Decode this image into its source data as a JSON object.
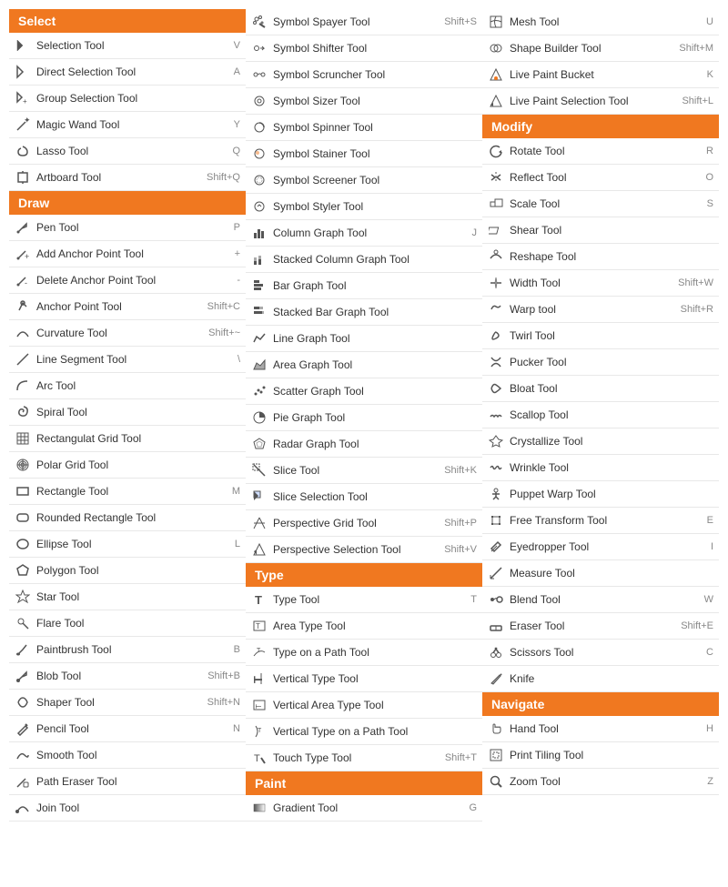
{
  "columns": [
    {
      "sections": [
        {
          "header": "Select",
          "tools": [
            {
              "name": "Selection Tool",
              "shortcut": "V",
              "icon": "arrow"
            },
            {
              "name": "Direct Selection Tool",
              "shortcut": "A",
              "icon": "arrow-hollow"
            },
            {
              "name": "Group Selection Tool",
              "shortcut": "",
              "icon": "arrow-plus"
            },
            {
              "name": "Magic Wand Tool",
              "shortcut": "Y",
              "icon": "wand"
            },
            {
              "name": "Lasso Tool",
              "shortcut": "Q",
              "icon": "lasso"
            },
            {
              "name": "Artboard Tool",
              "shortcut": "Shift+Q",
              "icon": "artboard"
            }
          ]
        },
        {
          "header": "Draw",
          "tools": [
            {
              "name": "Pen Tool",
              "shortcut": "P",
              "icon": "pen"
            },
            {
              "name": "Add Anchor Point Tool",
              "shortcut": "+",
              "icon": "pen-plus"
            },
            {
              "name": "Delete Anchor Point Tool",
              "shortcut": "-",
              "icon": "pen-minus"
            },
            {
              "name": "Anchor Point Tool",
              "shortcut": "Shift+C",
              "icon": "anchor"
            },
            {
              "name": "Curvature Tool",
              "shortcut": "Shift+~",
              "icon": "curvature"
            },
            {
              "name": "Line Segment Tool",
              "shortcut": "\\",
              "icon": "line"
            },
            {
              "name": "Arc Tool",
              "shortcut": "",
              "icon": "arc"
            },
            {
              "name": "Spiral Tool",
              "shortcut": "",
              "icon": "spiral"
            },
            {
              "name": "Rectangulat Grid Tool",
              "shortcut": "",
              "icon": "rect-grid"
            },
            {
              "name": "Polar Grid Tool",
              "shortcut": "",
              "icon": "polar-grid"
            },
            {
              "name": "Rectangle Tool",
              "shortcut": "M",
              "icon": "rect"
            },
            {
              "name": "Rounded Rectangle Tool",
              "shortcut": "",
              "icon": "rounded-rect"
            },
            {
              "name": "Ellipse Tool",
              "shortcut": "L",
              "icon": "ellipse"
            },
            {
              "name": "Polygon Tool",
              "shortcut": "",
              "icon": "polygon"
            },
            {
              "name": "Star Tool",
              "shortcut": "",
              "icon": "star"
            },
            {
              "name": "Flare Tool",
              "shortcut": "",
              "icon": "flare"
            },
            {
              "name": "Paintbrush Tool",
              "shortcut": "B",
              "icon": "brush"
            },
            {
              "name": "Blob Tool",
              "shortcut": "Shift+B",
              "icon": "blob"
            },
            {
              "name": "Shaper Tool",
              "shortcut": "Shift+N",
              "icon": "shaper"
            },
            {
              "name": "Pencil Tool",
              "shortcut": "N",
              "icon": "pencil"
            },
            {
              "name": "Smooth Tool",
              "shortcut": "",
              "icon": "smooth"
            },
            {
              "name": "Path Eraser Tool",
              "shortcut": "",
              "icon": "path-eraser"
            },
            {
              "name": "Join Tool",
              "shortcut": "",
              "icon": "join"
            }
          ]
        }
      ]
    },
    {
      "sections": [
        {
          "header": "",
          "tools": [
            {
              "name": "Symbol Spayer Tool",
              "shortcut": "Shift+S",
              "icon": "symbol-spray"
            },
            {
              "name": "Symbol Shifter Tool",
              "shortcut": "",
              "icon": "symbol-shift"
            },
            {
              "name": "Symbol Scruncher Tool",
              "shortcut": "",
              "icon": "symbol-scrunch"
            },
            {
              "name": "Symbol Sizer Tool",
              "shortcut": "",
              "icon": "symbol-size"
            },
            {
              "name": "Symbol Spinner Tool",
              "shortcut": "",
              "icon": "symbol-spin"
            },
            {
              "name": "Symbol Stainer Tool",
              "shortcut": "",
              "icon": "symbol-stain"
            },
            {
              "name": "Symbol Screener Tool",
              "shortcut": "",
              "icon": "symbol-screen"
            },
            {
              "name": "Symbol Styler Tool",
              "shortcut": "",
              "icon": "symbol-style"
            },
            {
              "name": "Column Graph Tool",
              "shortcut": "J",
              "icon": "col-graph"
            },
            {
              "name": "Stacked Column Graph Tool",
              "shortcut": "",
              "icon": "stacked-col-graph"
            },
            {
              "name": "Bar Graph Tool",
              "shortcut": "",
              "icon": "bar-graph"
            },
            {
              "name": "Stacked Bar Graph Tool",
              "shortcut": "",
              "icon": "stacked-bar-graph"
            },
            {
              "name": "Line Graph Tool",
              "shortcut": "",
              "icon": "line-graph"
            },
            {
              "name": "Area Graph Tool",
              "shortcut": "",
              "icon": "area-graph"
            },
            {
              "name": "Scatter Graph Tool",
              "shortcut": "",
              "icon": "scatter-graph"
            },
            {
              "name": "Pie Graph Tool",
              "shortcut": "",
              "icon": "pie-graph"
            },
            {
              "name": "Radar Graph Tool",
              "shortcut": "",
              "icon": "radar-graph"
            },
            {
              "name": "Slice Tool",
              "shortcut": "Shift+K",
              "icon": "slice"
            },
            {
              "name": "Slice Selection Tool",
              "shortcut": "",
              "icon": "slice-select"
            },
            {
              "name": "Perspective Grid Tool",
              "shortcut": "Shift+P",
              "icon": "persp-grid"
            },
            {
              "name": "Perspective Selection Tool",
              "shortcut": "Shift+V",
              "icon": "persp-select"
            }
          ]
        },
        {
          "header": "Type",
          "tools": [
            {
              "name": "Type Tool",
              "shortcut": "T",
              "icon": "type"
            },
            {
              "name": "Area Type Tool",
              "shortcut": "",
              "icon": "area-type"
            },
            {
              "name": "Type on a Path Tool",
              "shortcut": "",
              "icon": "type-path"
            },
            {
              "name": "Vertical Type Tool",
              "shortcut": "",
              "icon": "vert-type"
            },
            {
              "name": "Vertical Area Type Tool",
              "shortcut": "",
              "icon": "vert-area-type"
            },
            {
              "name": "Vertical Type on a Path Tool",
              "shortcut": "",
              "icon": "vert-type-path"
            },
            {
              "name": "Touch Type Tool",
              "shortcut": "Shift+T",
              "icon": "touch-type"
            }
          ]
        },
        {
          "header": "Paint",
          "tools": [
            {
              "name": "Gradient Tool",
              "shortcut": "G",
              "icon": "gradient"
            }
          ]
        }
      ]
    },
    {
      "sections": [
        {
          "header": "",
          "tools": [
            {
              "name": "Mesh Tool",
              "shortcut": "U",
              "icon": "mesh"
            },
            {
              "name": "Shape Builder Tool",
              "shortcut": "Shift+M",
              "icon": "shape-builder"
            },
            {
              "name": "Live Paint Bucket",
              "shortcut": "K",
              "icon": "live-paint"
            },
            {
              "name": "Live Paint Selection Tool",
              "shortcut": "Shift+L",
              "icon": "live-paint-select"
            }
          ]
        },
        {
          "header": "Modify",
          "tools": [
            {
              "name": "Rotate Tool",
              "shortcut": "R",
              "icon": "rotate"
            },
            {
              "name": "Reflect Tool",
              "shortcut": "O",
              "icon": "reflect"
            },
            {
              "name": "Scale Tool",
              "shortcut": "S",
              "icon": "scale"
            },
            {
              "name": "Shear Tool",
              "shortcut": "",
              "icon": "shear"
            },
            {
              "name": "Reshape Tool",
              "shortcut": "",
              "icon": "reshape"
            },
            {
              "name": "Width Tool",
              "shortcut": "Shift+W",
              "icon": "width"
            },
            {
              "name": "Warp tool",
              "shortcut": "Shift+R",
              "icon": "warp"
            },
            {
              "name": "Twirl Tool",
              "shortcut": "",
              "icon": "twirl"
            },
            {
              "name": "Pucker Tool",
              "shortcut": "",
              "icon": "pucker"
            },
            {
              "name": "Bloat Tool",
              "shortcut": "",
              "icon": "bloat"
            },
            {
              "name": "Scallop Tool",
              "shortcut": "",
              "icon": "scallop"
            },
            {
              "name": "Crystallize Tool",
              "shortcut": "",
              "icon": "crystallize"
            },
            {
              "name": "Wrinkle Tool",
              "shortcut": "",
              "icon": "wrinkle"
            },
            {
              "name": "Puppet Warp Tool",
              "shortcut": "",
              "icon": "puppet-warp"
            },
            {
              "name": "Free Transform Tool",
              "shortcut": "E",
              "icon": "free-transform"
            },
            {
              "name": "Eyedropper Tool",
              "shortcut": "I",
              "icon": "eyedropper"
            },
            {
              "name": "Measure Tool",
              "shortcut": "",
              "icon": "measure"
            },
            {
              "name": "Blend Tool",
              "shortcut": "W",
              "icon": "blend"
            },
            {
              "name": "Eraser Tool",
              "shortcut": "Shift+E",
              "icon": "eraser"
            },
            {
              "name": "Scissors Tool",
              "shortcut": "C",
              "icon": "scissors"
            },
            {
              "name": "Knife",
              "shortcut": "",
              "icon": "knife"
            }
          ]
        },
        {
          "header": "Navigate",
          "tools": [
            {
              "name": "Hand Tool",
              "shortcut": "H",
              "icon": "hand"
            },
            {
              "name": "Print Tiling Tool",
              "shortcut": "",
              "icon": "print-tile"
            },
            {
              "name": "Zoom Tool",
              "shortcut": "Z",
              "icon": "zoom"
            }
          ]
        }
      ]
    }
  ],
  "colors": {
    "header_bg": "#f07820",
    "header_text": "#ffffff",
    "border": "#e0e0e0"
  }
}
